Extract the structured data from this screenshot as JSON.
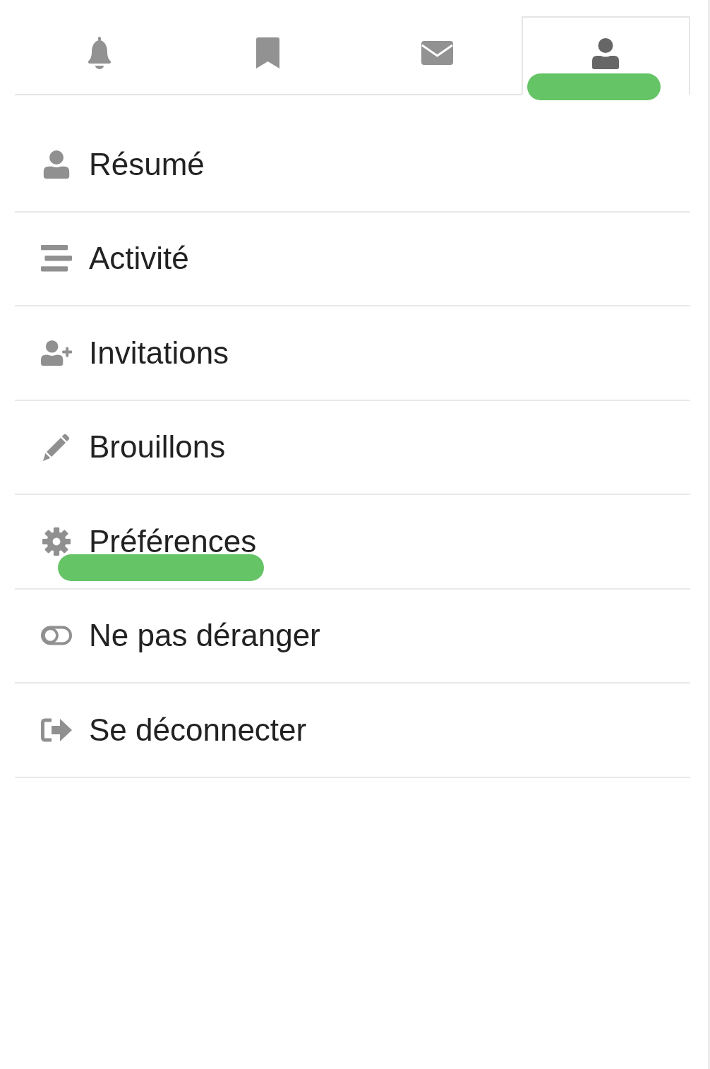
{
  "tabs": [
    {
      "selected": false,
      "highlighted": false
    },
    {
      "selected": false,
      "highlighted": false
    },
    {
      "selected": false,
      "highlighted": false
    },
    {
      "selected": true,
      "highlighted": true
    }
  ],
  "menu": {
    "items": [
      {
        "label": "Résumé",
        "highlighted": false
      },
      {
        "label": "Activité",
        "highlighted": false
      },
      {
        "label": "Invitations",
        "highlighted": false
      },
      {
        "label": "Brouillons",
        "highlighted": false
      },
      {
        "label": "Préférences",
        "highlighted": true
      },
      {
        "label": "Ne pas déranger",
        "highlighted": false
      },
      {
        "label": "Se déconnecter",
        "highlighted": false
      }
    ]
  }
}
